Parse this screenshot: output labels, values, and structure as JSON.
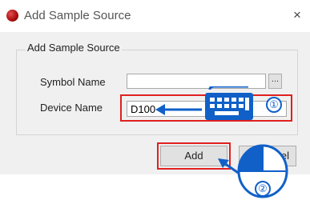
{
  "window": {
    "title": "Add Sample Source",
    "close_glyph": "×"
  },
  "group": {
    "legend": "Add Sample Source"
  },
  "symbol_name": {
    "label": "Symbol Name",
    "value": "",
    "browse_label": "..."
  },
  "device_name": {
    "label": "Device Name",
    "value": "D100"
  },
  "buttons": {
    "add": "Add",
    "cancel_partial": "cel"
  },
  "annotations": {
    "step1": "①",
    "step2": "②",
    "accent_color": "#1060c8",
    "highlight_color": "#e02020"
  },
  "icons": {
    "app": "red-circle-icon",
    "keyboard": "keyboard-icon",
    "mouse": "mouse-icon"
  }
}
